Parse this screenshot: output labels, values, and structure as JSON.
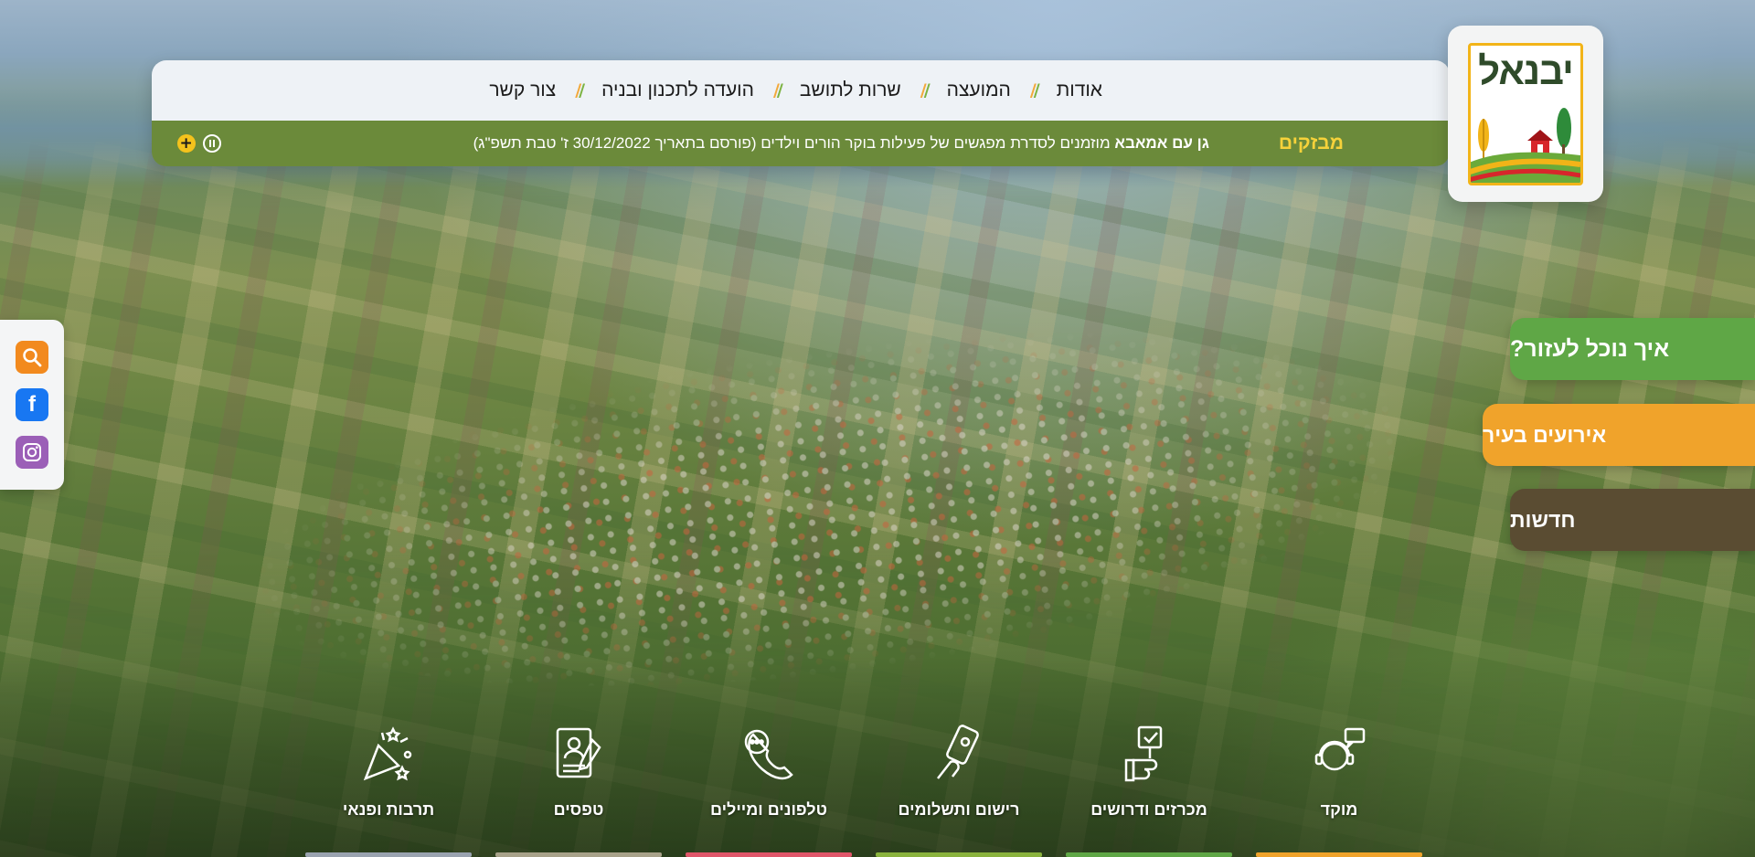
{
  "site": {
    "logo_text": "יבנאל"
  },
  "nav": {
    "items": [
      {
        "label": "אודות"
      },
      {
        "label": "המועצה"
      },
      {
        "label": "שרות לתושב"
      },
      {
        "label": "הועדה לתכנון ובניה"
      },
      {
        "label": "צור קשר"
      }
    ],
    "separator": "//"
  },
  "ticker": {
    "label": "מבזקים",
    "headline_bold": "גן עם אמאבא",
    "headline_rest": " מוזמנים לסדרת מפגשים של פעילות בוקר הורים וילדים  (פורסם בתאריך 30/12/2022 ז' טבת תשפ\"ג)",
    "pause_icon": "pause-icon",
    "plus_icon": "plus-icon",
    "plus_symbol": "+"
  },
  "side_tabs": {
    "help": "איך נוכל לעזור?",
    "events": "אירועים בעיר",
    "news": "חדשות"
  },
  "social": {
    "items": [
      {
        "icon": "search-icon",
        "color": "#f28a1e"
      },
      {
        "icon": "facebook-icon",
        "color": "#1877f2",
        "glyph": "f"
      },
      {
        "icon": "instagram-icon",
        "color": "#9b5fb7"
      }
    ]
  },
  "quick_links": {
    "items": [
      {
        "label": "מוקד",
        "icon": "call-center-icon",
        "bar_color": "#f0a32b"
      },
      {
        "label": "מכרזים ודרושים",
        "icon": "tender-icon",
        "bar_color": "#5fa746"
      },
      {
        "label": "רישום ותשלומים",
        "icon": "payment-icon",
        "bar_color": "#8ab33d"
      },
      {
        "label": "טלפונים ומיילים",
        "icon": "phone-icon",
        "bar_color": "#e0566a"
      },
      {
        "label": "טפסים",
        "icon": "form-icon",
        "bar_color": "#a8a28a"
      },
      {
        "label": "תרבות ופנאי",
        "icon": "party-icon",
        "bar_color": "#9aa3b0"
      }
    ]
  },
  "colors": {
    "nav_bg": "#eef2f6",
    "ticker_bg": "#6b8a3a",
    "ticker_label": "#f6d23a",
    "accent_green": "#5fa746",
    "accent_orange": "#f0a32b",
    "accent_brown": "#5a4c32"
  }
}
